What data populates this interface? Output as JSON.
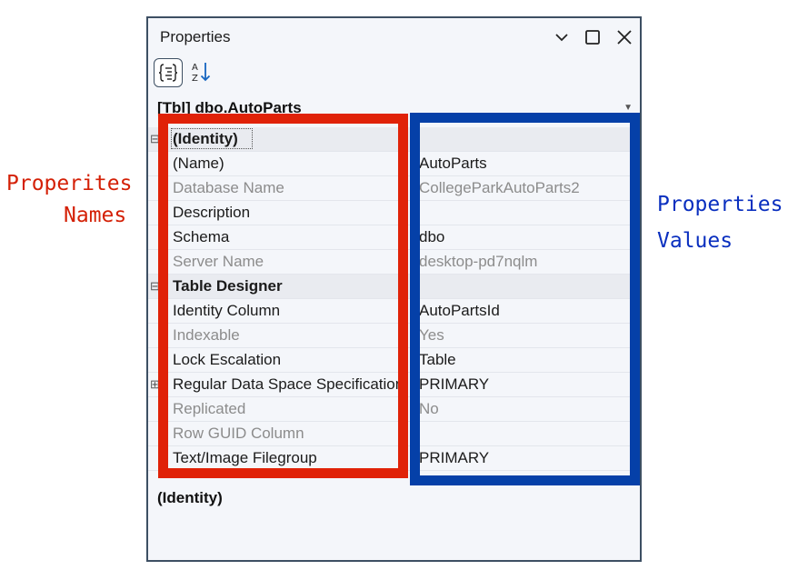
{
  "window": {
    "title": "Properties"
  },
  "toolbar": {
    "categorized_icon": "categorized-icon",
    "alphabetical_icon": "sort-alphabetical-icon"
  },
  "object_selector": {
    "value": "[Tbl] dbo.AutoParts"
  },
  "property_grid": {
    "rows": [
      {
        "type": "category",
        "name": "(Identity)",
        "value": "",
        "expander": "⊟"
      },
      {
        "type": "property",
        "name": "(Name)",
        "value": "AutoParts",
        "muted": false
      },
      {
        "type": "property",
        "name": "Database Name",
        "value": "CollegeParkAutoParts2",
        "muted": true
      },
      {
        "type": "property",
        "name": "Description",
        "value": "",
        "muted": false
      },
      {
        "type": "property",
        "name": "Schema",
        "value": "dbo",
        "muted": false
      },
      {
        "type": "property",
        "name": "Server Name",
        "value": "desktop-pd7nqlm",
        "muted": true
      },
      {
        "type": "category",
        "name": "Table Designer",
        "value": "",
        "expander": "⊟"
      },
      {
        "type": "property",
        "name": "Identity Column",
        "value": "AutoPartsId",
        "muted": false
      },
      {
        "type": "property",
        "name": "Indexable",
        "value": "Yes",
        "muted": true
      },
      {
        "type": "property",
        "name": "Lock Escalation",
        "value": "Table",
        "muted": false
      },
      {
        "type": "property",
        "name": "Regular Data Space Specification",
        "value": "PRIMARY",
        "muted": false,
        "expander": "⊞"
      },
      {
        "type": "property",
        "name": "Replicated",
        "value": "No",
        "muted": true
      },
      {
        "type": "property",
        "name": "Row GUID Column",
        "value": "",
        "muted": true
      },
      {
        "type": "property",
        "name": "Text/Image Filegroup",
        "value": "PRIMARY",
        "muted": false
      }
    ]
  },
  "description_pane": {
    "title": "(Identity)"
  },
  "annotations": {
    "names_line1": "Properites",
    "names_line2": "Names",
    "values_line1": "Properties",
    "values_line2": "Values",
    "names_color": "#e02208",
    "values_color": "#0540a8"
  }
}
